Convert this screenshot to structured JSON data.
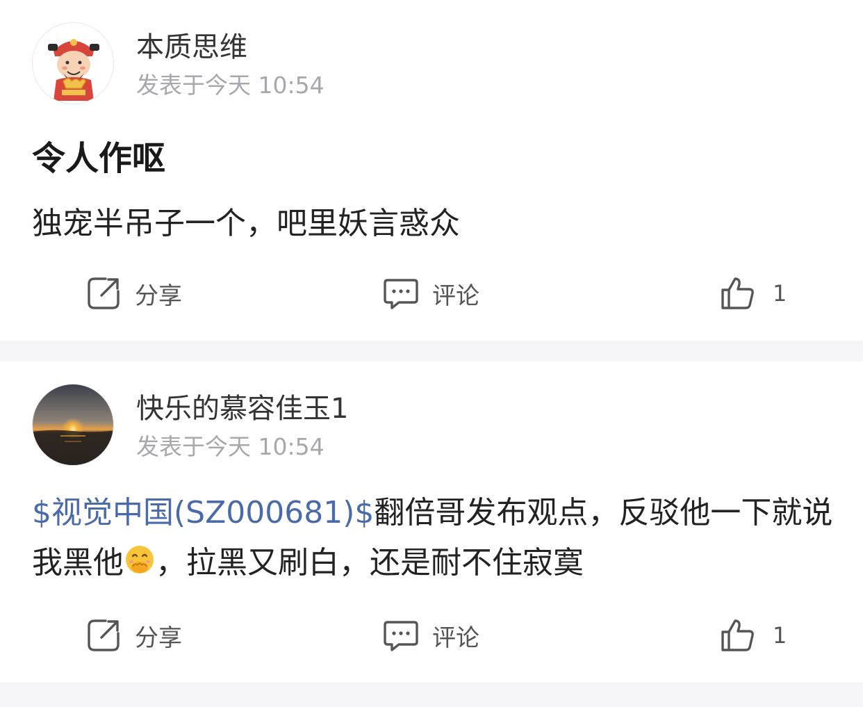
{
  "colors": {
    "link": "#4a6aa8",
    "muted": "#a7a7ad",
    "separator": "#f5f5f7",
    "icon": "#555555"
  },
  "posts": [
    {
      "author": "本质思维",
      "time": "发表于今天 10:54",
      "avatar_icon": "caishen-cartoon-avatar",
      "title": "令人作呕",
      "body": "独宠半吊子一个，吧里妖言惑众",
      "share_label": "分享",
      "comment_label": "评论",
      "like_count": "1"
    },
    {
      "author": "快乐的慕容佳玉1",
      "time": "发表于今天 10:54",
      "avatar_icon": "sunset-photo-avatar",
      "stock_tag": "$视觉中国(SZ000681)$",
      "body_part1": "翻倍哥发布观点，反驳他一下就说我黑他",
      "emoji": "hand-over-mouth-emoji",
      "body_part2": "，拉黑又刷白，还是耐不住寂寞",
      "share_label": "分享",
      "comment_label": "评论",
      "like_count": "1"
    }
  ]
}
